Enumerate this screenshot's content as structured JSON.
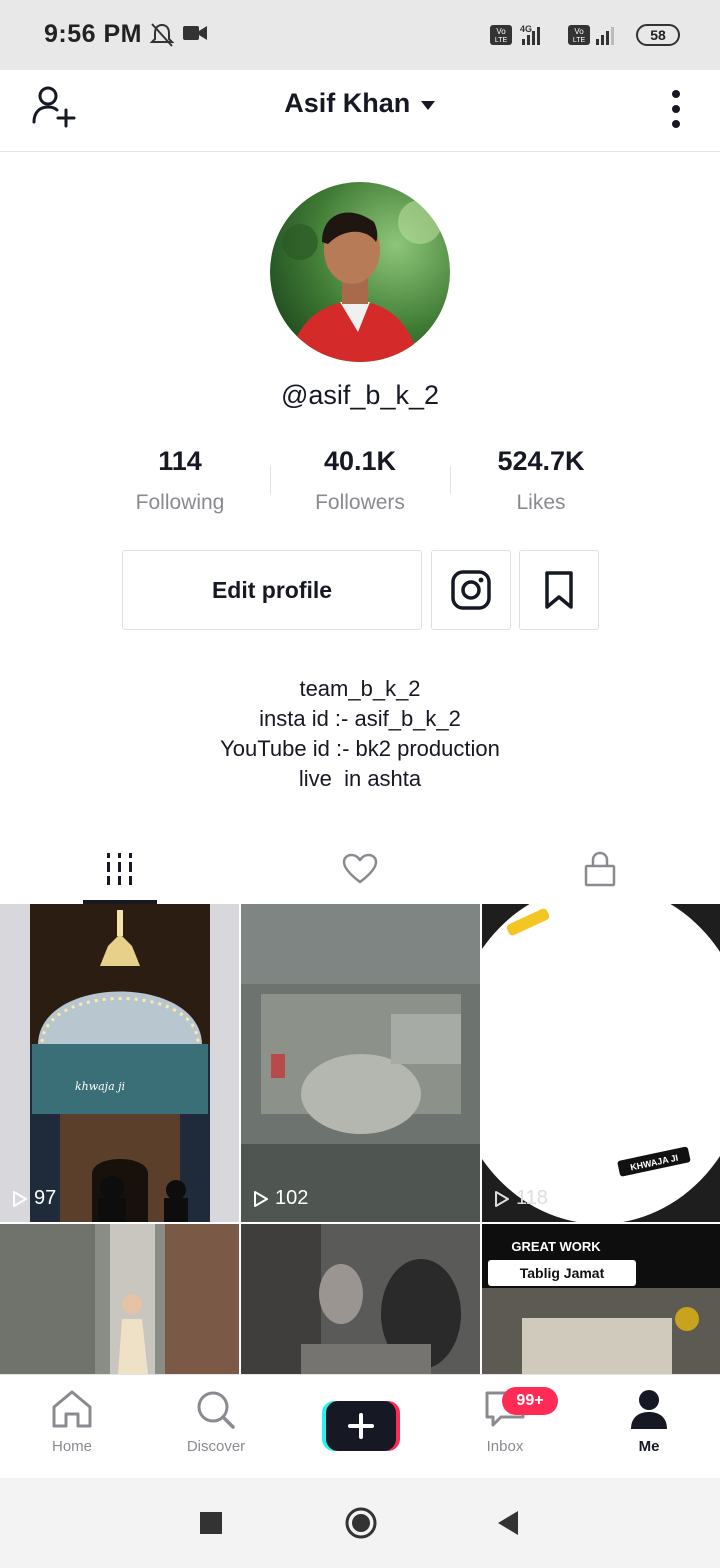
{
  "status_bar": {
    "time": "9:56 PM",
    "battery": "58"
  },
  "header": {
    "account_name": "Asif Khan"
  },
  "profile": {
    "handle": "@asif_b_k_2",
    "stats": [
      {
        "value": "114",
        "label": "Following"
      },
      {
        "value": "40.1K",
        "label": "Followers"
      },
      {
        "value": "524.7K",
        "label": "Likes"
      }
    ],
    "edit_button": "Edit profile",
    "bio": [
      "team_b_k_2",
      "insta id :- asif_b_k_2",
      "YouTube id :- bk2 production",
      "live  in ashta"
    ]
  },
  "videos": [
    {
      "views": "97",
      "caption": "khwaja ji"
    },
    {
      "views": "102",
      "caption": ""
    },
    {
      "views": "118",
      "caption": "KHWAJA JI"
    },
    {
      "views": "",
      "caption": ""
    },
    {
      "views": "",
      "caption": ""
    },
    {
      "views": "",
      "caption": "GREAT WORK",
      "caption2": "Tablig Jamat"
    }
  ],
  "bottom_nav": {
    "items": [
      {
        "label": "Home",
        "icon": "home-icon"
      },
      {
        "label": "Discover",
        "icon": "search-icon"
      },
      {
        "label": "",
        "icon": "create-icon"
      },
      {
        "label": "Inbox",
        "icon": "inbox-icon"
      },
      {
        "label": "Me",
        "icon": "profile-icon"
      }
    ],
    "inbox_badge": "99+"
  },
  "colors": {
    "accent": "#fe2c55",
    "cyan": "#25f4ee",
    "text": "#161823",
    "muted": "#8a8b91"
  }
}
